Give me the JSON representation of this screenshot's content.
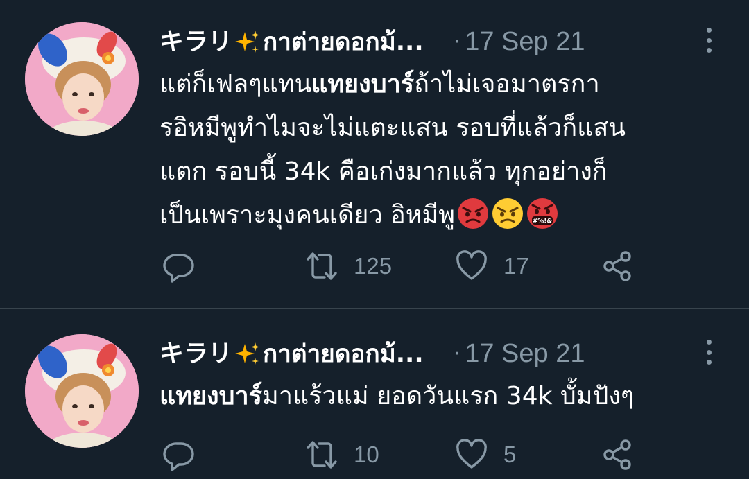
{
  "tweets": [
    {
      "display_name": "キラリ",
      "display_name_rest": "กาต่ายดอกม้...",
      "dot": "·",
      "timestamp": "17 Sep 21",
      "lines": [
        [
          {
            "text": "แต่ก็เฟลๆแทน",
            "bold": false
          },
          {
            "text": "แทยงบาร์",
            "bold": true
          },
          {
            "text": "ถ้าไม่เจอมาตรกา",
            "bold": false
          }
        ],
        [
          {
            "text": "รอิหมีพูทำไมจะไม่แตะแสน รอบที่แล้วก็แสน",
            "bold": false
          }
        ],
        [
          {
            "text": "แตก รอบนี้ 34k คือเก่งมากแล้ว ทุกอย่างก็",
            "bold": false
          }
        ],
        [
          {
            "text": "เป็นเพราะมุงคนเดียว อิหมีพู",
            "bold": false
          }
        ]
      ],
      "line_emojis": [
        "angry-red-face-emoji",
        "angry-face-emoji",
        "cursing-face-emoji"
      ],
      "counts": {
        "reply": "",
        "retweet": "125",
        "like": "17"
      }
    },
    {
      "display_name": "キラリ",
      "display_name_rest": "กาต่ายดอกม้...",
      "dot": "·",
      "timestamp": "17 Sep 21",
      "lines": [
        [
          {
            "text": "แทยงบาร์",
            "bold": true
          },
          {
            "text": "มาแร้วแม่ ยอดวันแรก 34k บั้มปังๆ",
            "bold": false
          }
        ]
      ],
      "line_emojis": [],
      "counts": {
        "reply": "",
        "retweet": "10",
        "like": "5"
      }
    }
  ],
  "icons": {
    "reply": "reply-icon",
    "retweet": "retweet-icon",
    "like": "heart-icon",
    "share": "share-icon",
    "more": "more-options-icon",
    "sparkle": "sparkles-icon"
  },
  "colors": {
    "background": "#15202b",
    "text": "#ffffff",
    "secondary": "#8899a6",
    "divider": "#38444d",
    "avatar_bg": "#f2a9c8"
  }
}
